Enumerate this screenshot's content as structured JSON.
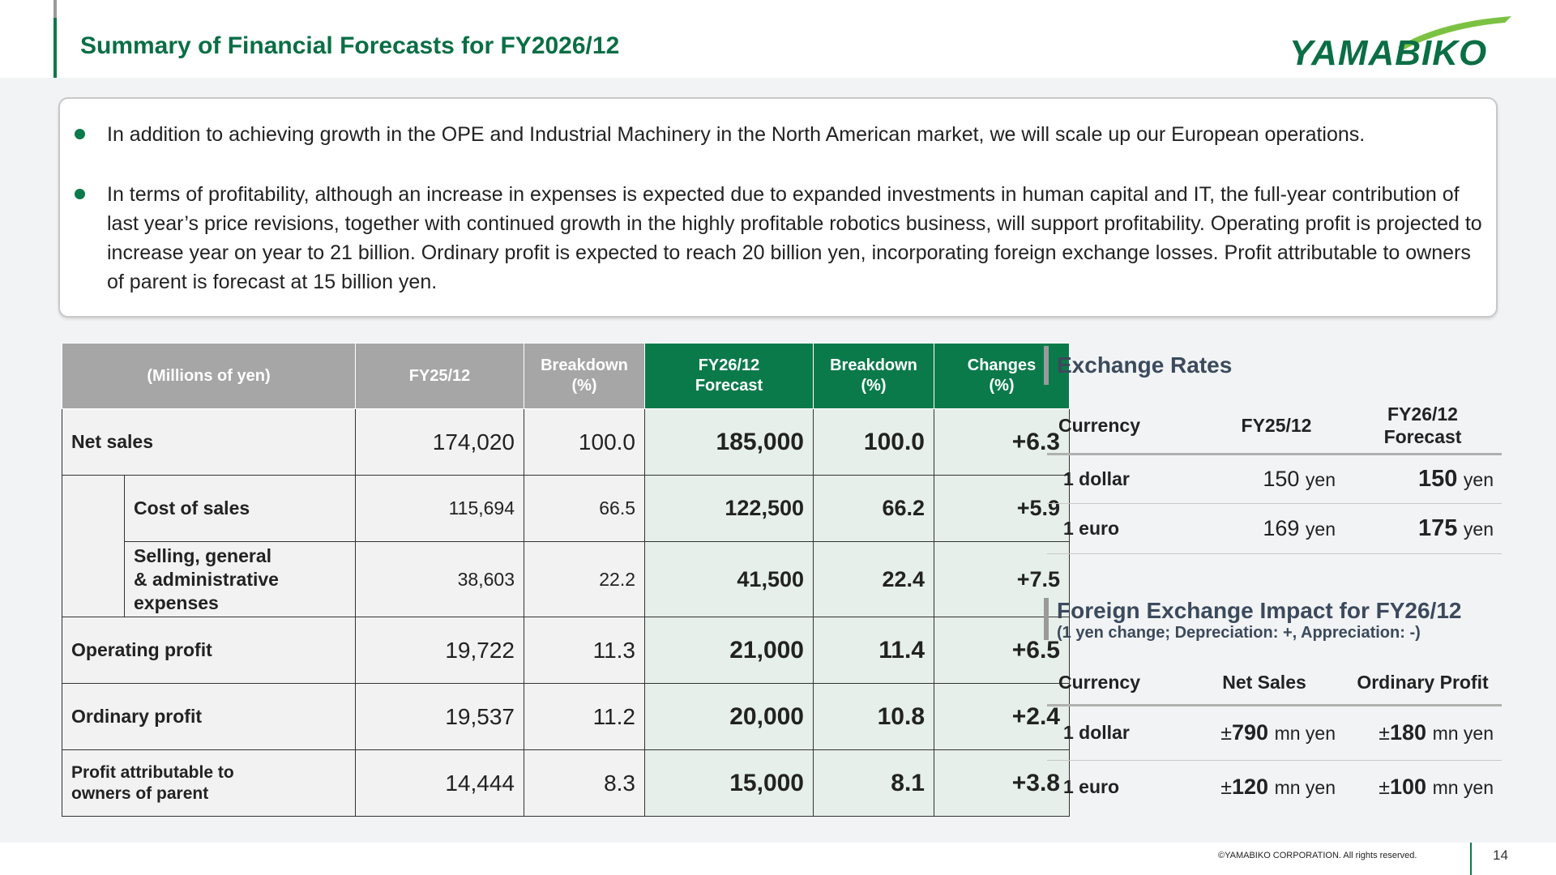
{
  "header": {
    "title": "Summary of Financial Forecasts for FY2026/12",
    "logo_text": "YAMABIKO"
  },
  "summary": {
    "bullets": [
      "In addition to achieving growth in the OPE and Industrial Machinery in the North American market, we will scale up our European operations.",
      "In terms of profitability, although an increase in expenses is expected due to expanded investments in human capital and IT, the full-year contribution of last year’s price revisions, together with continued growth in the highly profitable robotics business, will support profitability. Operating profit is projected to increase year on year to 21 billion. Ordinary profit is expected to reach 20 billion yen, incorporating foreign exchange losses. Profit attributable to owners of parent is forecast at 15 billion yen."
    ]
  },
  "financial_table": {
    "headers": {
      "unit": "(Millions of yen)",
      "fy25": "FY25/12",
      "breakdown1_a": "Breakdown",
      "breakdown1_b": "(%)",
      "fy26_a": "FY26/12",
      "fy26_b": "Forecast",
      "breakdown2_a": "Breakdown",
      "breakdown2_b": "(%)",
      "changes_a": "Changes",
      "changes_b": "(%)"
    },
    "rows": [
      {
        "label": "Net sales",
        "fy25": "174,020",
        "bd25": "100.0",
        "fy26": "185,000",
        "bd26": "100.0",
        "chg": "+6.3"
      },
      {
        "label": "Cost of sales",
        "fy25": "115,694",
        "bd25": "66.5",
        "fy26": "122,500",
        "bd26": "66.2",
        "chg": "+5.9"
      },
      {
        "label_a": "Selling, general",
        "label_b": "& administrative",
        "label_c": "expenses",
        "fy25": "38,603",
        "bd25": "22.2",
        "fy26": "41,500",
        "bd26": "22.4",
        "chg": "+7.5"
      },
      {
        "label": "Operating profit",
        "fy25": "19,722",
        "bd25": "11.3",
        "fy26": "21,000",
        "bd26": "11.4",
        "chg": "+6.5"
      },
      {
        "label": "Ordinary profit",
        "fy25": "19,537",
        "bd25": "11.2",
        "fy26": "20,000",
        "bd26": "10.8",
        "chg": "+2.4"
      },
      {
        "label_a": "Profit attributable to",
        "label_b": "owners of parent",
        "fy25": "14,444",
        "bd25": "8.3",
        "fy26": "15,000",
        "bd26": "8.1",
        "chg": "+3.8"
      }
    ]
  },
  "exchange_rates": {
    "title": "Exchange Rates",
    "headers": {
      "currency": "Currency",
      "fy25": "FY25/12",
      "fy26_a": "FY26/12",
      "fy26_b": "Forecast"
    },
    "unit": "yen",
    "rows": [
      {
        "currency": "1 dollar",
        "fy25": "150",
        "fy26": "150"
      },
      {
        "currency": "1 euro",
        "fy25": "169",
        "fy26": "175"
      }
    ]
  },
  "fx_impact": {
    "title": "Foreign Exchange Impact for FY26/12",
    "subtitle": "(1 yen change; Depreciation: +, Appreciation: -)",
    "headers": {
      "currency": "Currency",
      "net_sales": "Net Sales",
      "ordinary_profit": "Ordinary Profit"
    },
    "pm": "±",
    "unit": "mn yen",
    "rows": [
      {
        "currency": "1 dollar",
        "net_sales": "790",
        "ordinary_profit": "180"
      },
      {
        "currency": "1 euro",
        "net_sales": "120",
        "ordinary_profit": "100"
      }
    ]
  },
  "footer": {
    "copyright": "©YAMABIKO CORPORATION. All rights reserved.",
    "page": "14"
  },
  "colors": {
    "brand_green": "#0b7a4b",
    "header_gray": "#a6a6a6",
    "section_title": "#3b4a5c"
  }
}
